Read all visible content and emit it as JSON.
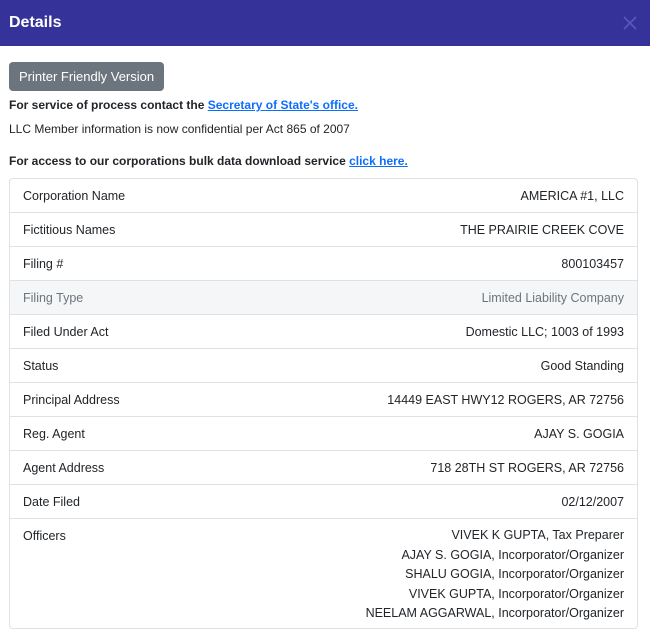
{
  "header": {
    "title": "Details",
    "close_icon": "close-icon"
  },
  "printer_button_label": "Printer Friendly Version",
  "service_line": {
    "prefix": "For service of process contact the ",
    "link_text": "Secretary of State's office."
  },
  "llc_notice": "LLC Member information is now confidential per Act 865 of 2007",
  "bulk_line": {
    "prefix": "For access to our corporations bulk data download service ",
    "link_text": "click here."
  },
  "details": [
    {
      "label": "Corporation Name",
      "value": "AMERICA #1, LLC"
    },
    {
      "label": "Fictitious Names",
      "value": "THE PRAIRIE CREEK COVE"
    },
    {
      "label": "Filing #",
      "value": "800103457"
    },
    {
      "label": "Filing Type",
      "value": "Limited Liability Company"
    },
    {
      "label": "Filed Under Act",
      "value": "Domestic LLC; 1003 of 1993"
    },
    {
      "label": "Status",
      "value": "Good Standing"
    },
    {
      "label": "Principal Address",
      "value": "14449 EAST HWY12 ROGERS, AR 72756"
    },
    {
      "label": "Reg. Agent",
      "value": "AJAY S. GOGIA"
    },
    {
      "label": "Agent Address",
      "value": "718 28TH ST ROGERS, AR 72756"
    },
    {
      "label": "Date Filed",
      "value": "02/12/2007"
    }
  ],
  "officers": {
    "label": "Officers",
    "list": [
      "VIVEK K GUPTA, Tax Preparer",
      "AJAY S. GOGIA, Incorporator/Organizer",
      "SHALU GOGIA, Incorporator/Organizer",
      "VIVEK GUPTA, Incorporator/Organizer",
      "NEELAM AGGARWAL, Incorporator/Organizer"
    ]
  },
  "colors": {
    "header_bg": "#35339a",
    "button_bg": "#6c757d",
    "link": "#0d6efd"
  }
}
